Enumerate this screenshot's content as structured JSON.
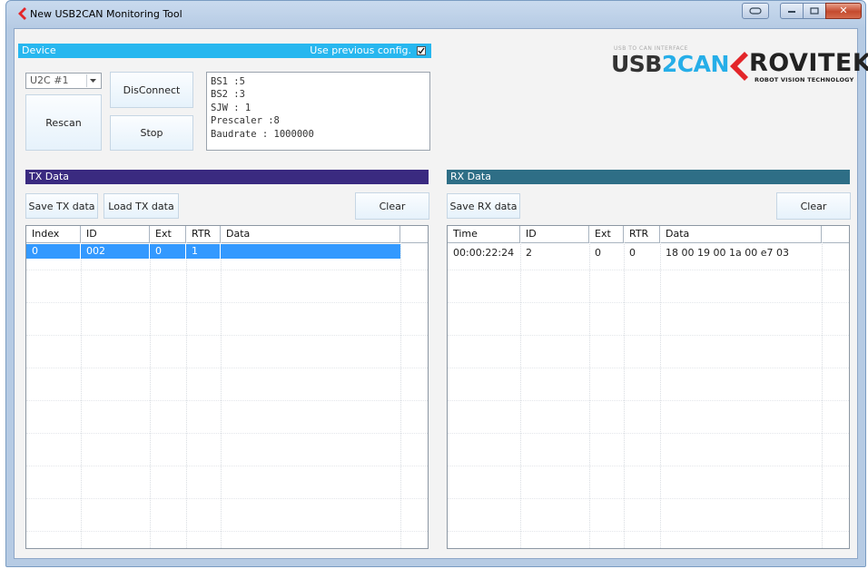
{
  "window": {
    "title": "New USB2CAN Monitoring Tool",
    "close_glyph": "✕"
  },
  "device": {
    "section_label": "Device",
    "use_previous_label": "Use previous config.",
    "use_previous_checked": true,
    "port_select_value": "U2C #1",
    "rescan_label": "Rescan",
    "disconnect_label": "DisConnect",
    "stop_label": "Stop",
    "info_lines": [
      "BS1 :5",
      "BS2 :3",
      "SJW : 1",
      "Prescaler :8",
      "Baudrate : 1000000"
    ]
  },
  "logo": {
    "usb2can_tagline": "USB TO CAN INTERFACE",
    "usb2can_part1": "USB",
    "usb2can_part2": "2CAN",
    "rovitek": "ROVITEK",
    "rovitek_tagline": "ROBOT VISION TECHNOLOGY",
    "accent_red": "#e3262a",
    "accent_blue": "#26aee8"
  },
  "tx": {
    "section_label": "TX Data",
    "save_label": "Save TX data",
    "load_label": "Load TX data",
    "clear_label": "Clear",
    "columns": [
      "Index",
      "ID",
      "Ext",
      "RTR",
      "Data"
    ],
    "rows": [
      {
        "index": "0",
        "id": "002",
        "ext": "0",
        "rtr": "1",
        "data": ""
      }
    ]
  },
  "rx": {
    "section_label": "RX Data",
    "save_label": "Save RX data",
    "clear_label": "Clear",
    "columns": [
      "Time",
      "ID",
      "Ext",
      "RTR",
      "Data"
    ],
    "rows": [
      {
        "time": "00:00:22:24",
        "id": "2",
        "ext": "0",
        "rtr": "0",
        "data": "18 00 19 00 1a 00 e7 03"
      }
    ]
  }
}
